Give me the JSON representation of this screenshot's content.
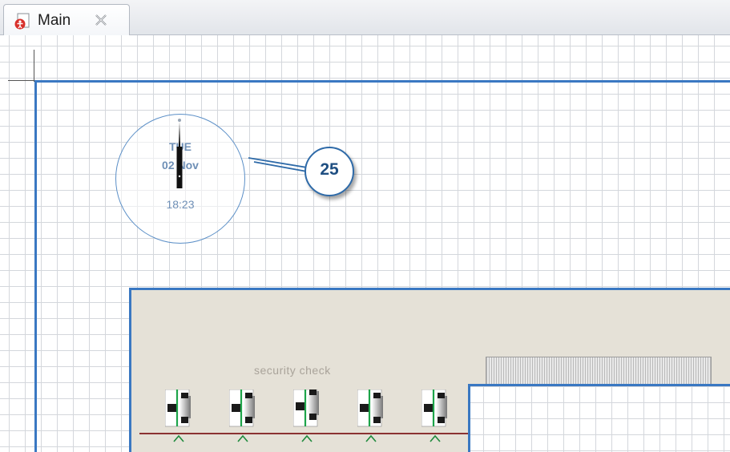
{
  "tab": {
    "label": "Main"
  },
  "clock": {
    "day": "TUE",
    "date": "02 Nov",
    "time": "18:23"
  },
  "callout": {
    "number": "25"
  },
  "building": {
    "security_label": "security check"
  },
  "icons": [
    "tab-file-icon",
    "close-icon",
    "gate-icon",
    "arrow-up-icon"
  ],
  "colors": {
    "accent": "#3a78c2",
    "conveyor": "#8b3232",
    "floor": "#e5e1d7"
  }
}
